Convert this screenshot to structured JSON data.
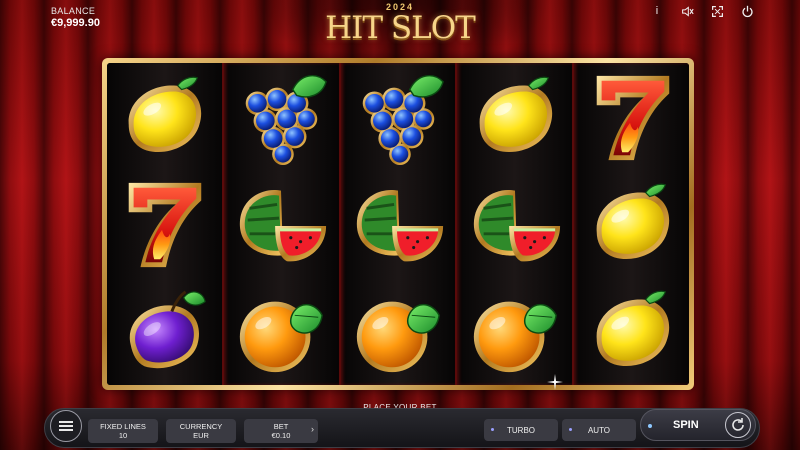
{
  "balance": {
    "label": "BALANCE",
    "value": "€9,999.90"
  },
  "logo": {
    "year": "2024",
    "title": "HIT SLOT"
  },
  "top_icons": [
    "info-icon",
    "sound-icon",
    "fullscreen-icon",
    "power-icon"
  ],
  "top_icon_glyphs": {
    "info": "i"
  },
  "reels": [
    [
      "lemon",
      "seven",
      "plum"
    ],
    [
      "grapes",
      "watermelon",
      "orange"
    ],
    [
      "grapes",
      "watermelon",
      "orange"
    ],
    [
      "lemon",
      "watermelon",
      "orange"
    ],
    [
      "seven",
      "lemon",
      "lemon"
    ]
  ],
  "banner": "PLACE YOUR BET",
  "controls": {
    "lines_label": "FIXED LINES",
    "lines_value": "10",
    "currency_label": "CURRENCY",
    "currency_value": "EUR",
    "bet_label": "BET",
    "bet_value": "€0.10",
    "bet_arrow": "›",
    "turbo_label": "TURBO",
    "auto_label": "AUTO",
    "spin_label": "SPIN"
  },
  "colors": {
    "gold": "#f6d48a",
    "curtain_red": "#a80f12",
    "bar_dark": "#141418"
  }
}
